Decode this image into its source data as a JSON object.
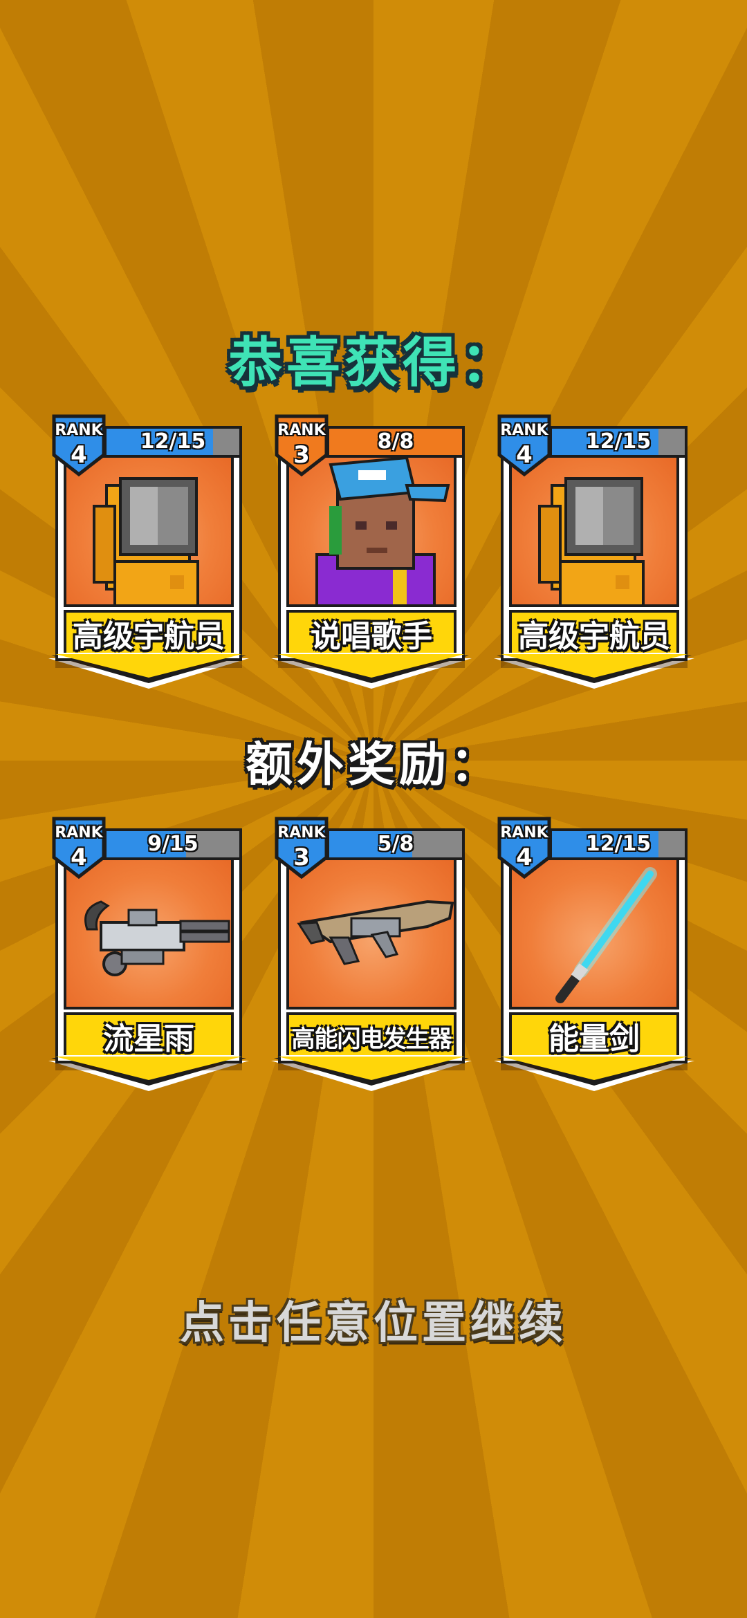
{
  "header": {
    "title": "恭喜获得："
  },
  "rewards": [
    {
      "rank_label": "RANK",
      "rank": "4",
      "count": "12/15",
      "progress": 0.8,
      "progress_color": "blue",
      "name": "高级宇航员",
      "art": "astronaut-character-icon"
    },
    {
      "rank_label": "RANK",
      "rank": "3",
      "count": "8/8",
      "progress": 1.0,
      "progress_color": "orange",
      "name": "说唱歌手",
      "art": "rapper-character-icon"
    },
    {
      "rank_label": "RANK",
      "rank": "4",
      "count": "12/15",
      "progress": 0.8,
      "progress_color": "blue",
      "name": "高级宇航员",
      "art": "astronaut-character-icon"
    }
  ],
  "bonus": {
    "title": "额外奖励："
  },
  "bonus_rewards": [
    {
      "rank_label": "RANK",
      "rank": "4",
      "count": "9/15",
      "progress": 0.6,
      "progress_color": "blue",
      "name": "流星雨",
      "art": "minigun-weapon-icon"
    },
    {
      "rank_label": "RANK",
      "rank": "3",
      "count": "5/8",
      "progress": 0.625,
      "progress_color": "blue",
      "name": "高能闪电发生器",
      "art": "lightning-rifle-weapon-icon"
    },
    {
      "rank_label": "RANK",
      "rank": "4",
      "count": "12/15",
      "progress": 0.8,
      "progress_color": "blue",
      "name": "能量剑",
      "art": "energy-sword-weapon-icon"
    }
  ],
  "footer": {
    "continue_label": "点击任意位置继续"
  },
  "colors": {
    "background": "#cf8a07",
    "title": "#3fe3b6",
    "card_portrait": "#f07e3a",
    "name_tag": "#ffd60a",
    "rank_blue": "#2f8ee8",
    "rank_orange": "#f07a1e"
  }
}
